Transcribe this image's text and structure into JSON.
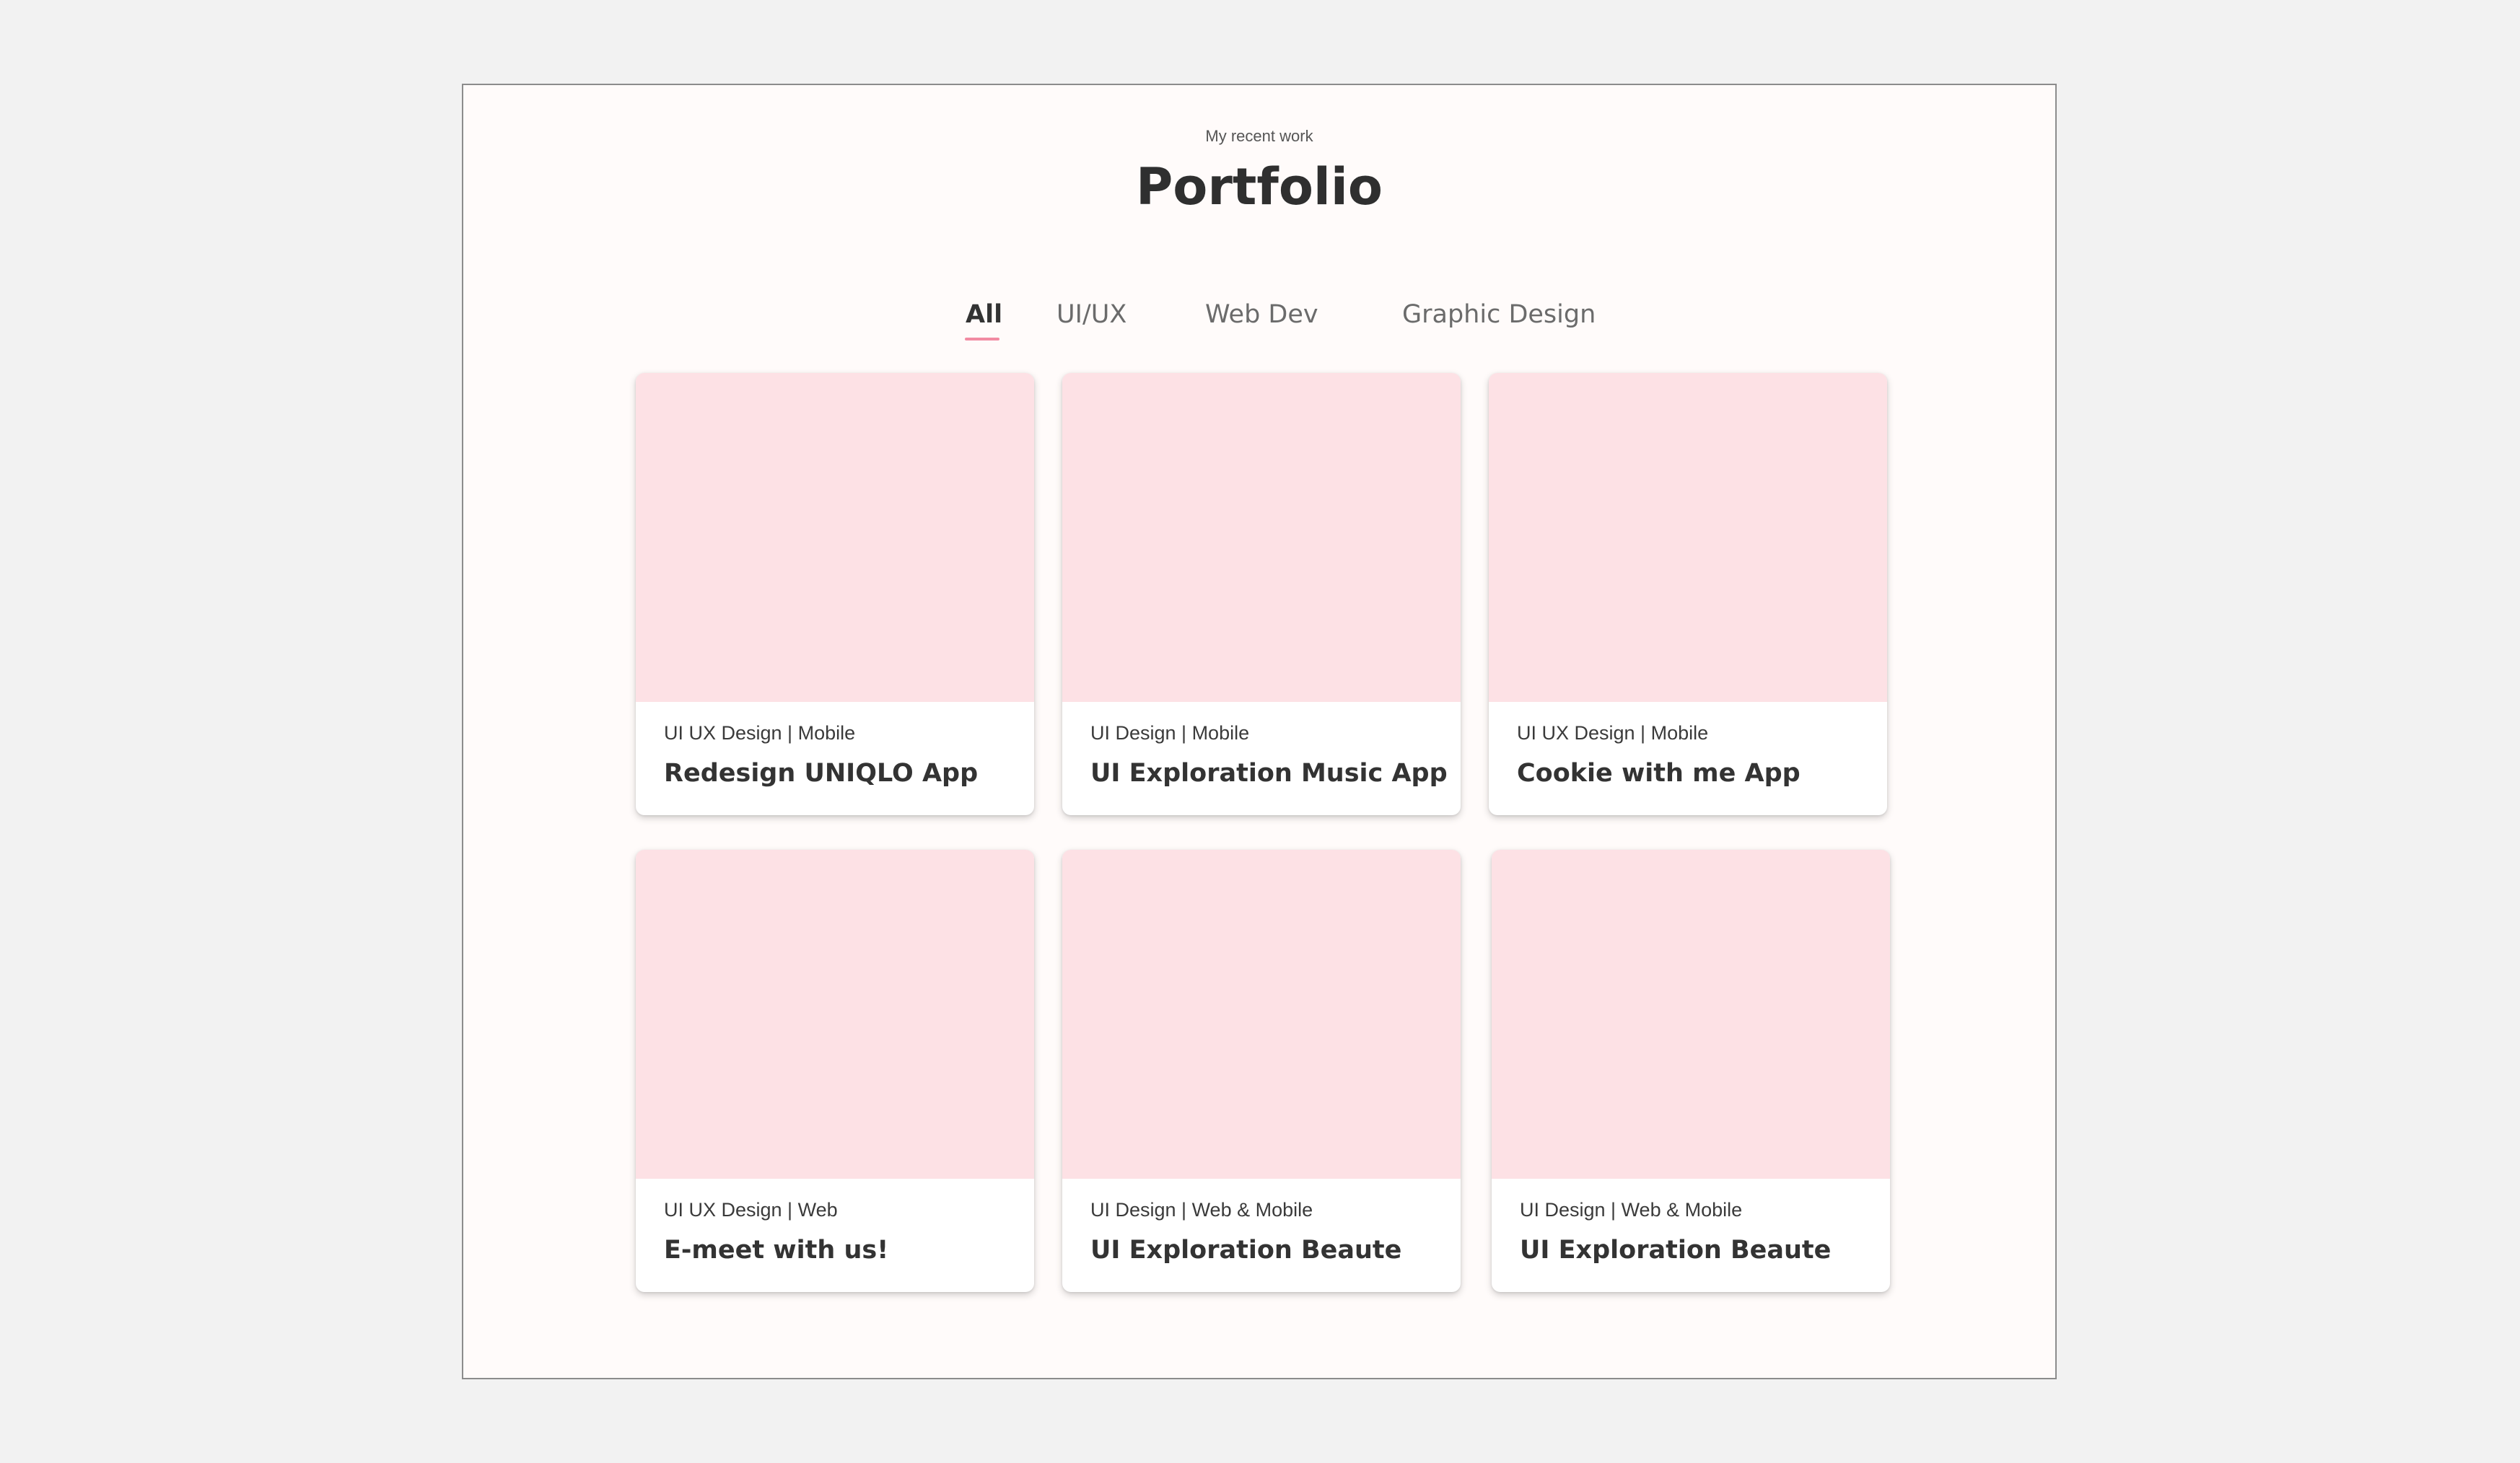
{
  "header": {
    "eyebrow": "My recent work",
    "title": "Portfolio"
  },
  "tabs": [
    {
      "label": "All",
      "active": true
    },
    {
      "label": "UI/UX",
      "active": false
    },
    {
      "label": "Web Dev",
      "active": false
    },
    {
      "label": "Graphic Design",
      "active": false
    }
  ],
  "projects": [
    {
      "category": "UI UX Design | Mobile",
      "title": "Redesign UNIQLO App"
    },
    {
      "category": "UI Design | Mobile",
      "title": "UI Exploration Music App"
    },
    {
      "category": "UI UX Design | Mobile",
      "title": "Cookie with me App"
    },
    {
      "category": "UI UX Design | Web",
      "title": "E-meet with us!"
    },
    {
      "category": "UI Design | Web & Mobile",
      "title": "UI Exploration Beaute"
    },
    {
      "category": "UI Design | Web & Mobile",
      "title": "UI Exploration Beaute"
    }
  ],
  "colors": {
    "page_background": "#f2f2f2",
    "frame_background": "#fffbfa",
    "thumbnail_placeholder": "#fde1e5",
    "active_tab_underline": "#f28ba2",
    "heading_text": "#2f2f2f"
  }
}
